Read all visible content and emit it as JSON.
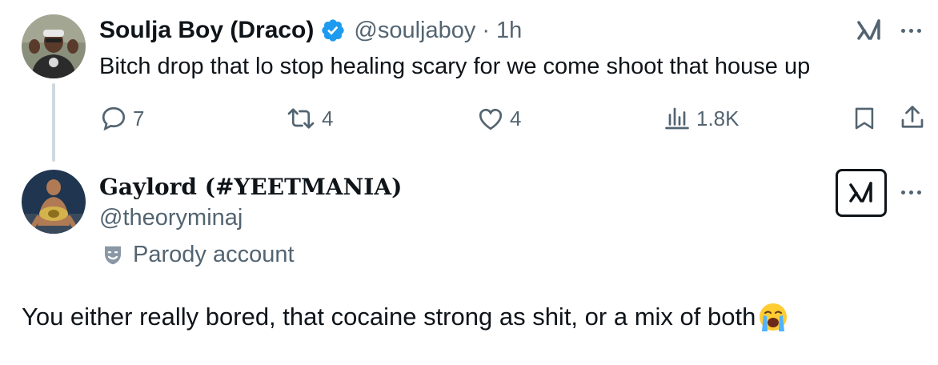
{
  "tweet": {
    "display_name": "Soulja Boy (Draco)",
    "handle": "@souljaboy",
    "separator": "·",
    "time": "1h",
    "text": "Bitch drop that lo stop healing scary for we come shoot that house up",
    "actions": {
      "replies": "7",
      "reposts": "4",
      "likes": "4",
      "views": "1.8K"
    },
    "verified_color": "#1d9bf0"
  },
  "reply": {
    "display_name": "Gaylord (#YEETMANIA)",
    "handle": "@theoryminaj",
    "badge_label": "Parody account",
    "text": "You either really bored, that cocaine strong as shit, or a mix of both",
    "emoji": "loudly-crying-face"
  },
  "colors": {
    "text_primary": "#0f1419",
    "text_secondary": "#536471",
    "thread_line": "#cfd9de"
  },
  "icons": [
    "verified-badge-icon",
    "grok-icon",
    "more-icon",
    "reply-icon",
    "repost-icon",
    "like-icon",
    "views-icon",
    "bookmark-icon",
    "share-icon",
    "parody-mask-icon"
  ]
}
